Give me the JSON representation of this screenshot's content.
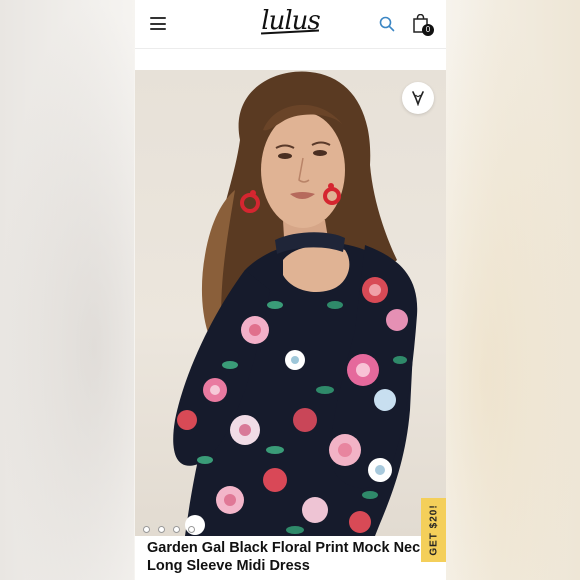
{
  "header": {
    "logo_text": "lulus",
    "cart_count": "0",
    "icons": [
      "menu-icon",
      "search-icon",
      "shopping-bag-icon"
    ]
  },
  "gallery": {
    "favorite_icon": "heart-icon",
    "image_count": 4,
    "active_index": 0
  },
  "promo": {
    "label": "GET $20!"
  },
  "product": {
    "title": "Garden Gal Black Floral Print Mock Neck Long Sleeve Midi Dress"
  },
  "colors": {
    "promo_bg": "#f4cf5a",
    "search_icon": "#3b86c4",
    "dress": "#161b2c",
    "accent_earrings": "#d52630"
  }
}
